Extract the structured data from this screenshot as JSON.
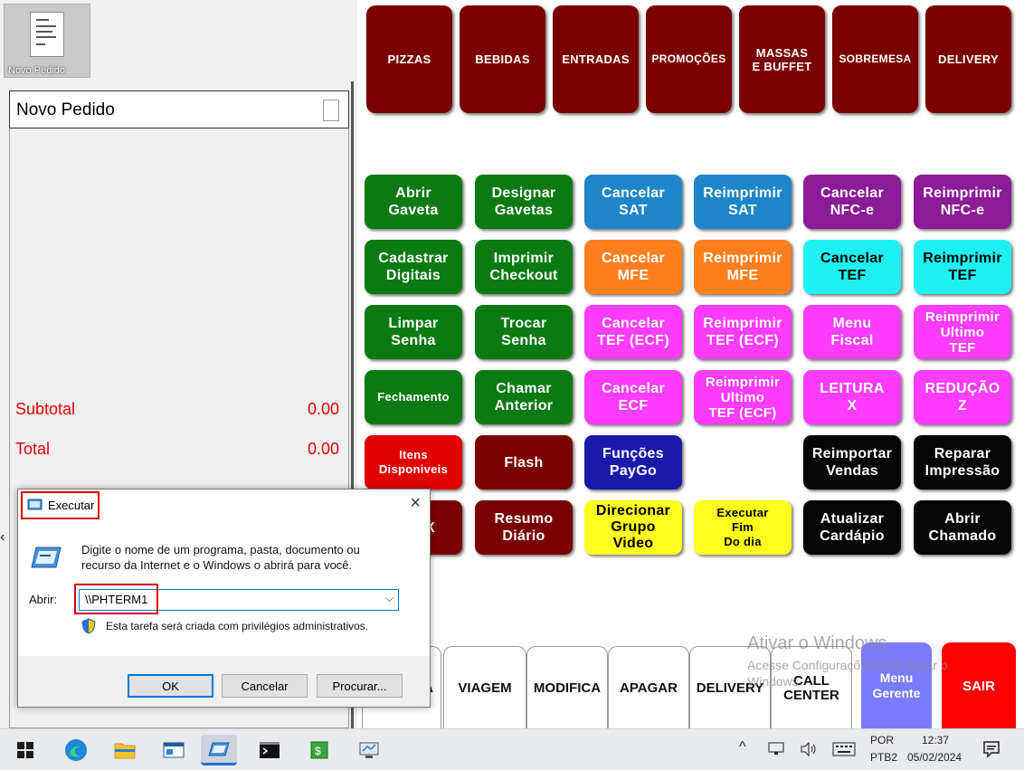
{
  "left_panel": {
    "thumbnail_caption": "Novo Pedido",
    "order_title": "Novo Pedido",
    "subtotal_label": "Subtotal",
    "subtotal_value": "0.00",
    "total_label": "Total",
    "total_value": "0.00"
  },
  "categories": [
    "PIZZAS",
    "BEBIDAS",
    "ENTRADAS",
    "PROMOÇÕES",
    "MASSAS\nE BUFFET",
    "SOBREMESA",
    "DELIVERY"
  ],
  "actions": {
    "abrir_gaveta": "Abrir\nGaveta",
    "designar_gavetas": "Designar\nGavetas",
    "cancelar_sat": "Cancelar\nSAT",
    "reimprimir_sat": "Reimprimir\nSAT",
    "cancelar_nfce": "Cancelar\nNFC-e",
    "reimprimir_nfce": "Reimprimir\nNFC-e",
    "cadastrar_digitais": "Cadastrar\nDigitais",
    "imprimir_checkout": "Imprimir\nCheckout",
    "cancelar_mfe": "Cancelar\nMFE",
    "reimprimir_mfe": "Reimprimir\nMFE",
    "cancelar_tef": "Cancelar\nTEF",
    "reimprimir_tef": "Reimprimir\nTEF",
    "limpar_senha": "Limpar\nSenha",
    "trocar_senha": "Trocar\nSenha",
    "cancelar_tef_ecf": "Cancelar\nTEF (ECF)",
    "reimprimir_tef_ecf": "Reimprimir\nTEF (ECF)",
    "menu_fiscal": "Menu\nFiscal",
    "reimprimir_ultimo_tef": "Reimprimir\nUltimo\nTEF",
    "fechamento": "Fechamento",
    "chamar_anterior": "Chamar\nAnterior",
    "cancelar_ecf": "Cancelar\nECF",
    "reimprimir_ultimo_tef_ecf": "Reimprimir\nUltimo\nTEF (ECF)",
    "leitura_x": "LEITURA\nX",
    "reducao_z": "REDUÇÃO\nZ",
    "itens_disponiveis": "Itens\nDisponiveis",
    "flash": "Flash",
    "funcoes_paygo": "Funções\nPayGo",
    "reimportar_vendas": "Reimportar\nVendas",
    "reparar_impressao": "Reparar\nImpressão",
    "partial_x": "X",
    "resumo_diario": "Resumo\nDiário",
    "direcionar_grupo_video": "Direcionar\nGrupo\nVideo",
    "executar_fim_do_dia": "Executar\nFim\nDo dia",
    "atualizar_cardapio": "Atualizar\nCardápio",
    "abrir_chamado": "Abrir\nChamado"
  },
  "bottom_tabs": {
    "partial_a": "A",
    "viagem": "VIAGEM",
    "modifica": "MODIFICA",
    "apagar": "APAGAR",
    "delivery": "DELIVERY",
    "call_center": "CALL\nCENTER",
    "menu_gerente": "Menu\nGerente",
    "sair": "SAIR"
  },
  "run_dialog": {
    "title": "Executar",
    "description": "Digite o nome de um programa, pasta, documento ou\nrecurso da Internet e o Windows o abrirá para você.",
    "open_label": "Abrir:",
    "open_value": "\\\\PHTERM1",
    "admin_note": "Esta tarefa será criada com privilégios administrativos.",
    "ok": "OK",
    "cancel": "Cancelar",
    "browse": "Procurar..."
  },
  "watermark": {
    "line1": "Ativar o Windows",
    "line2": "Acesse Configurações para ativar o",
    "line3": "Windows."
  },
  "taskbar": {
    "lang_top": "POR",
    "lang_bottom": "PTB2",
    "time": "12:37",
    "date": "05/02/2024"
  },
  "colors": {
    "category": "#7a0000",
    "green": "#0b7a12",
    "blue": "#1e86c8",
    "purple": "#8b1b96",
    "orange": "#ff7f1e",
    "cyan": "#1ef0f0",
    "magenta": "#ff3cff",
    "red": "#e00000",
    "navy": "#1a1aa8",
    "yellow": "#ffff1e",
    "black": "#050505",
    "highlight": "#e00000"
  }
}
